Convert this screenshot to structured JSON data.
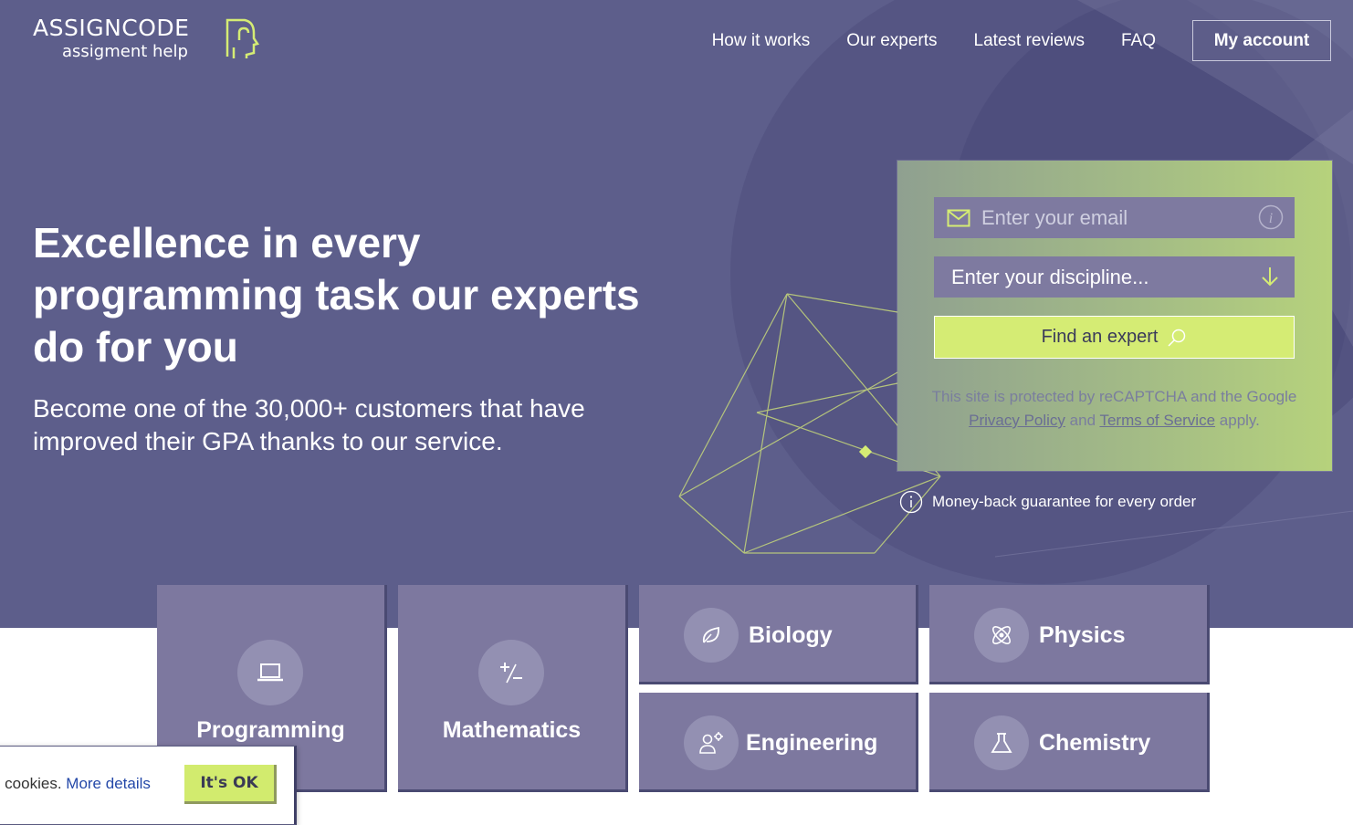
{
  "brand": {
    "name": "ASSIGNCODE",
    "tagline": "assigment help",
    "accent_color": "#d5ec74",
    "hero_color": "#5d5e8b",
    "tile_color": "#7d789f"
  },
  "nav": {
    "items": [
      {
        "label": "How it works"
      },
      {
        "label": "Our experts"
      },
      {
        "label": "Latest reviews"
      },
      {
        "label": "FAQ"
      }
    ],
    "account_label": "My account"
  },
  "hero": {
    "headline": "Excellence in every programming task our experts do for you",
    "subline": "Become one of the 30,000+ customers that have improved their GPA thanks to our service."
  },
  "form": {
    "email_placeholder": "Enter your email",
    "discipline_placeholder": "Enter your discipline...",
    "find_label": "Find an expert",
    "recaptcha_prefix": "This site is protected by reCAPTCHA and the Google",
    "privacy_label": "Privacy Policy",
    "and_label": "and",
    "terms_label": "Terms of Service",
    "apply_label": "apply."
  },
  "guarantee": {
    "text": "Money-back guarantee for every order",
    "icon": "info-circle-icon"
  },
  "subjects": [
    {
      "label": "Programming",
      "icon": "laptop-icon"
    },
    {
      "label": "Mathematics",
      "icon": "plus-minus-icon"
    },
    {
      "label": "Biology",
      "icon": "leaf-icon"
    },
    {
      "label": "Physics",
      "icon": "atom-icon"
    },
    {
      "label": "Engineering",
      "icon": "engineer-icon"
    },
    {
      "label": "Chemistry",
      "icon": "flask-icon"
    }
  ],
  "cookie": {
    "text": "e cookies.",
    "more_label": "More details",
    "ok_label": "It's OK"
  }
}
